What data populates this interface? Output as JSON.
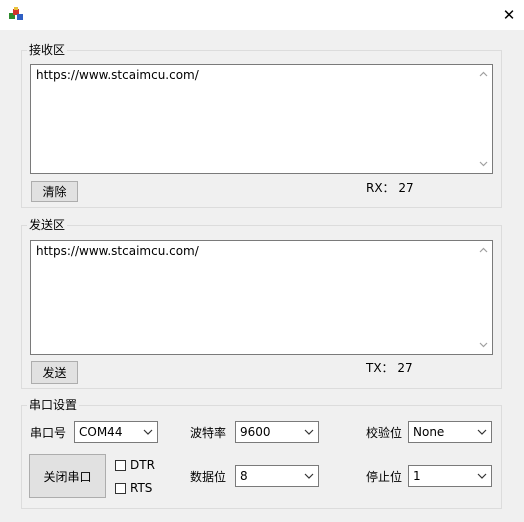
{
  "titlebar": {
    "close_glyph": "✕"
  },
  "receive": {
    "group_label": "接收区",
    "text": "https://www.stcaimcu.com/",
    "clear_label": "清除",
    "count_text": "RX： 27"
  },
  "send": {
    "group_label": "发送区",
    "text": "https://www.stcaimcu.com/",
    "send_label": "发送",
    "count_text": "TX： 27"
  },
  "serial": {
    "group_label": "串口设置",
    "port_label": "串口号",
    "port_value": "COM44",
    "baud_label": "波特率",
    "baud_value": "9600",
    "parity_label": "校验位",
    "parity_value": "None",
    "close_port_label": "关闭串口",
    "dtr_label": "DTR",
    "rts_label": "RTS",
    "databits_label": "数据位",
    "databits_value": "8",
    "stopbits_label": "停止位",
    "stopbits_value": "1"
  }
}
